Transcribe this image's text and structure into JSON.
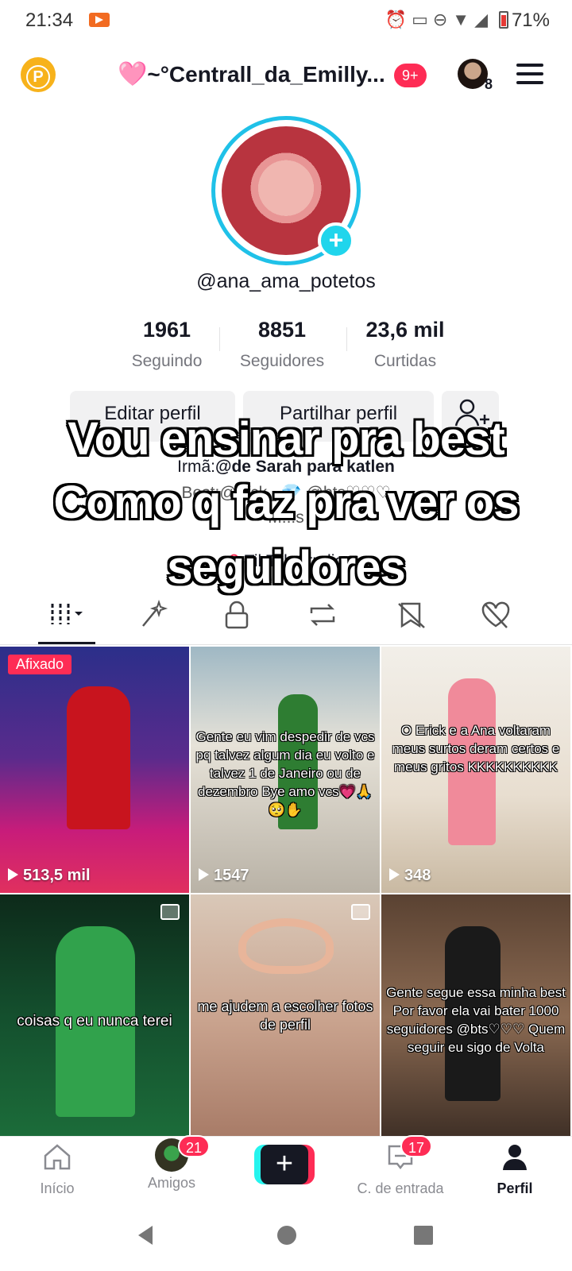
{
  "status_bar": {
    "time": "21:34",
    "battery": "71%"
  },
  "header": {
    "username": "~°Centrall_da_Emilly...",
    "heart": "🩷",
    "notif_badge": "9+",
    "accounts_count": "8",
    "points_label": "P"
  },
  "profile": {
    "handle": "@ana_ama_potetos",
    "stats": [
      {
        "num": "1961",
        "label": "Seguindo"
      },
      {
        "num": "8851",
        "label": "Seguidores"
      },
      {
        "num": "23,6 mil",
        "label": "Curtidas"
      }
    ],
    "edit_button": "Editar perfil",
    "share_button": "Partilhar perfil",
    "bio_line1_prefix": "Irmã:",
    "bio_line1_rest": "@de Sarah para katlen",
    "bio_line2": "Best:@_fck_ 💎 @bts♡♡♡",
    "bio_line3": "M...s",
    "studio": "TikTok Studio"
  },
  "overlay": {
    "line1": "Vou ensinar pra best",
    "line2": "Como q faz pra ver os",
    "line3": "seguidores"
  },
  "tabs": [
    "videos",
    "reposts",
    "private",
    "repost",
    "liked-hidden",
    "favorites-hidden"
  ],
  "videos": [
    {
      "views": "513,5 mil",
      "pinned": "Afixado",
      "caption": ""
    },
    {
      "views": "1547",
      "caption": "Gente eu vim despedir de vcs pq talvez algum dia eu volto e talvez 1 de Janeiro ou de dezembro Bye amo vcs💗🙏 🥺✋"
    },
    {
      "views": "348",
      "caption": "O Erick e a Ana voltaram meus surtos deram certos e meus gritos KKKKKKKKKK"
    },
    {
      "views": "",
      "caption": "coisas q eu nunca terei"
    },
    {
      "views": "",
      "caption": "me ajudem a escolher fotos de perfil"
    },
    {
      "views": "",
      "caption": "Gente segue essa minha best Por favor ela vai bater 1000 seguidores @bts♡♡♡ Quem seguir eu sigo de Volta"
    }
  ],
  "bottom_nav": [
    {
      "label": "Início"
    },
    {
      "label": "Amigos",
      "badge": "21"
    },
    {
      "label": ""
    },
    {
      "label": "C. de entrada",
      "badge": "17"
    },
    {
      "label": "Perfil"
    }
  ],
  "colors": {
    "accent": "#fe2c55",
    "cyan": "#25f4ee",
    "text": "#161823",
    "muted": "#75767d"
  }
}
